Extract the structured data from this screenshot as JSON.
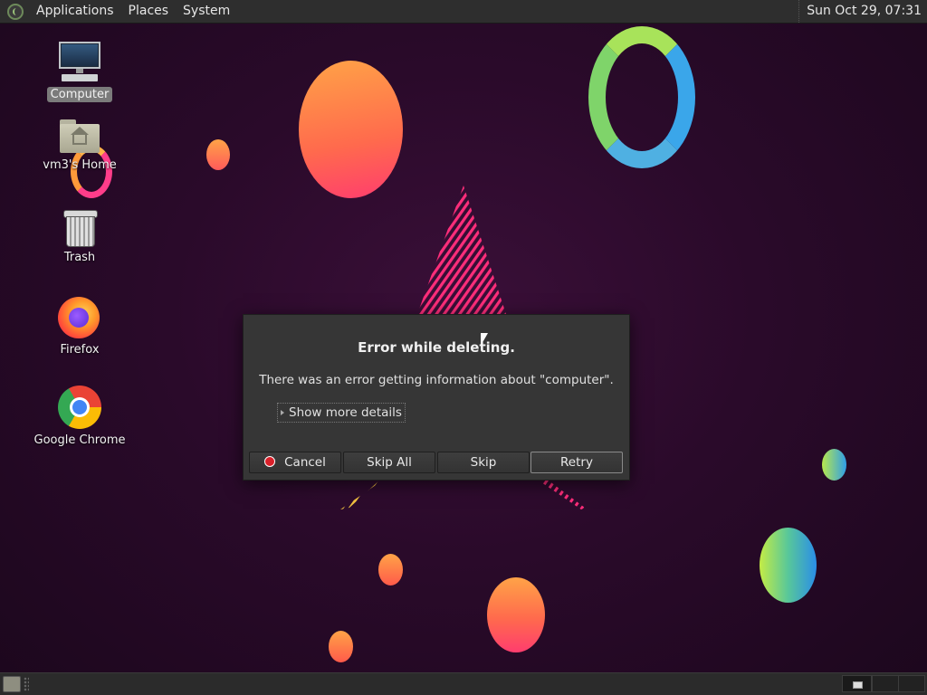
{
  "top_panel": {
    "menus": [
      "Applications",
      "Places",
      "System"
    ],
    "clock": "Sun Oct 29, 07:31"
  },
  "desktop": {
    "icons": [
      {
        "label": "Computer",
        "icon": "computer-icon",
        "selected": true
      },
      {
        "label": "vm3's Home",
        "icon": "home-folder-icon",
        "selected": false
      },
      {
        "label": "Trash",
        "icon": "trash-icon",
        "selected": false
      },
      {
        "label": "Firefox",
        "icon": "firefox-icon",
        "selected": false
      },
      {
        "label": "Google Chrome",
        "icon": "chrome-icon",
        "selected": false
      }
    ]
  },
  "dialog": {
    "title": "Error while deleting.",
    "message": "There was an error getting information about \"computer\".",
    "details_label": "Show more details",
    "buttons": {
      "cancel": "Cancel",
      "skip_all": "Skip All",
      "skip": "Skip",
      "retry": "Retry"
    }
  },
  "bottom_panel": {
    "icons": [
      "show-desktop-icon",
      "workspace-switcher"
    ]
  },
  "colors": {
    "background": "#2a0a2a",
    "panel": "#2e2e2e",
    "dialog": "#363636",
    "cancel_icon": "#d9202a"
  }
}
